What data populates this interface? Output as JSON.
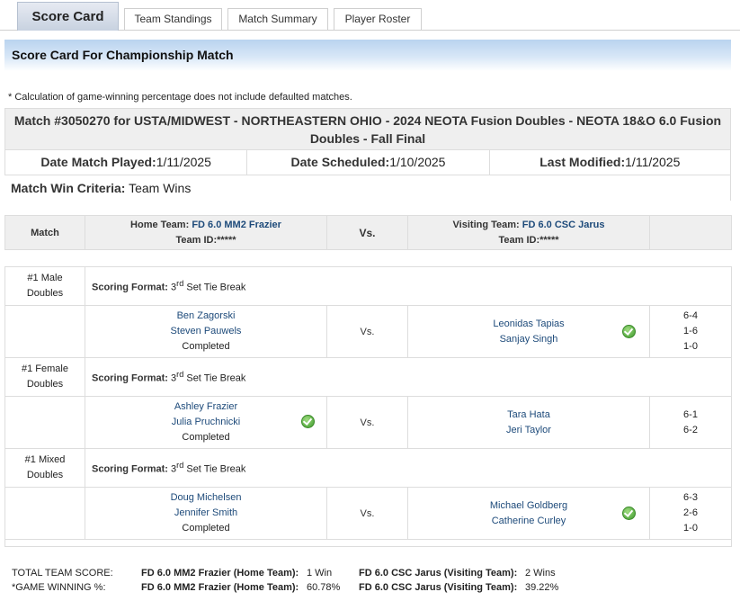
{
  "tabs": [
    "Score Card",
    "Team Standings",
    "Match Summary",
    "Player Roster"
  ],
  "banner_title": "Score Card For Championship Match",
  "note": "* Calculation of game-winning percentage does not include defaulted matches.",
  "match_title": "Match #3050270 for USTA/MIDWEST - NORTHEASTERN OHIO - 2024 NEOTA Fusion Doubles - NEOTA 18&O 6.0 Fusion Doubles - Fall Final",
  "dates": {
    "played_label": "Date Match Played:",
    "played": "1/11/2025",
    "scheduled_label": "Date Scheduled:",
    "scheduled": "1/10/2025",
    "modified_label": "Last Modified:",
    "modified": "1/11/2025"
  },
  "criteria": {
    "label": "Match Win Criteria:",
    "value": "Team Wins"
  },
  "header": {
    "match": "Match",
    "home_label": "Home Team:",
    "home_name": "FD 6.0 MM2 Frazier",
    "home_id_label": "Team ID:",
    "home_id": "*****",
    "vs": "Vs.",
    "visit_label": "Visiting Team:",
    "visit_name": "FD 6.0 CSC Jarus",
    "visit_id_label": "Team ID:",
    "visit_id": "*****"
  },
  "matches": [
    {
      "line1": "#1 Male",
      "line2": "Doubles",
      "format_label": "Scoring Format:",
      "format_num": "3",
      "format_sup": "rd",
      "format_rest": " Set Tie Break",
      "home": [
        "Ben Zagorski",
        "Steven Pauwels"
      ],
      "home_status": "Completed",
      "visit": [
        "Leonidas Tapias",
        "Sanjay Singh"
      ],
      "scores": [
        "6-4",
        "1-6",
        "1-0"
      ],
      "winner": "visiting"
    },
    {
      "line1": "#1 Female",
      "line2": "Doubles",
      "format_label": "Scoring Format:",
      "format_num": "3",
      "format_sup": "rd",
      "format_rest": " Set Tie Break",
      "home": [
        "Ashley Frazier",
        "Julia Pruchnicki"
      ],
      "home_status": "Completed",
      "visit": [
        "Tara Hata",
        "Jeri Taylor"
      ],
      "scores": [
        "6-1",
        "6-2"
      ],
      "winner": "home"
    },
    {
      "line1": "#1 Mixed",
      "line2": "Doubles",
      "format_label": "Scoring Format:",
      "format_num": "3",
      "format_sup": "rd",
      "format_rest": " Set Tie Break",
      "home": [
        "Doug Michelsen",
        "Jennifer Smith"
      ],
      "home_status": "Completed",
      "visit": [
        "Michael Goldberg",
        "Catherine Curley"
      ],
      "scores": [
        "6-3",
        "2-6",
        "1-0"
      ],
      "winner": "visiting"
    }
  ],
  "totals": {
    "total_label": "TOTAL TEAM SCORE:",
    "home_team_label": "FD 6.0 MM2 Frazier (Home Team):",
    "home_score": "1 Win",
    "visit_team_label": "FD 6.0 CSC Jarus (Visiting Team):",
    "visit_score": "2 Wins",
    "pct_label": "*GAME WINNING %:",
    "home_pct": "60.78%",
    "visit_pct": "39.22%"
  },
  "icons": {
    "winner": "check-circle-icon"
  },
  "colors": {
    "team_link": "#1d4a7a",
    "banner": "#b9d3ef",
    "check": "#3e9a2c"
  }
}
